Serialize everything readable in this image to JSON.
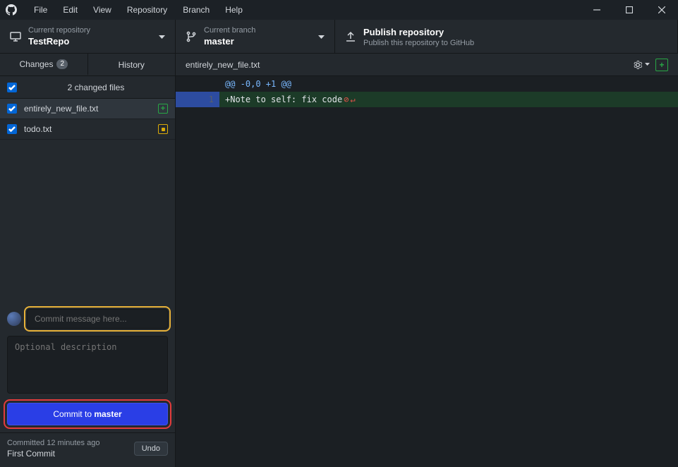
{
  "menu": [
    "File",
    "Edit",
    "View",
    "Repository",
    "Branch",
    "Help"
  ],
  "header": {
    "repo": {
      "label": "Current repository",
      "value": "TestRepo"
    },
    "branch": {
      "label": "Current branch",
      "value": "master"
    },
    "publish": {
      "label": "Publish repository",
      "sub": "Publish this repository to GitHub"
    }
  },
  "tabs": {
    "changes": {
      "label": "Changes",
      "count": "2"
    },
    "history": {
      "label": "History"
    }
  },
  "changesHeader": "2 changed files",
  "files": [
    {
      "name": "entirely_new_file.txt",
      "status": "added",
      "selected": true
    },
    {
      "name": "todo.txt",
      "status": "modified",
      "selected": false
    }
  ],
  "commitForm": {
    "summaryPlaceholder": "Commit message here...",
    "descPlaceholder": "Optional description",
    "buttonPrefix": "Commit to ",
    "buttonBranch": "master"
  },
  "lastCommit": {
    "meta": "Committed 12 minutes ago",
    "title": "First Commit",
    "undo": "Undo"
  },
  "diff": {
    "filename": "entirely_new_file.txt",
    "hunkHeader": "@@ -0,0 +1 @@",
    "lines": [
      {
        "lnNew": "1",
        "prefix": "+",
        "text": "Note to self: fix code",
        "type": "added",
        "noNewline": true
      }
    ]
  }
}
